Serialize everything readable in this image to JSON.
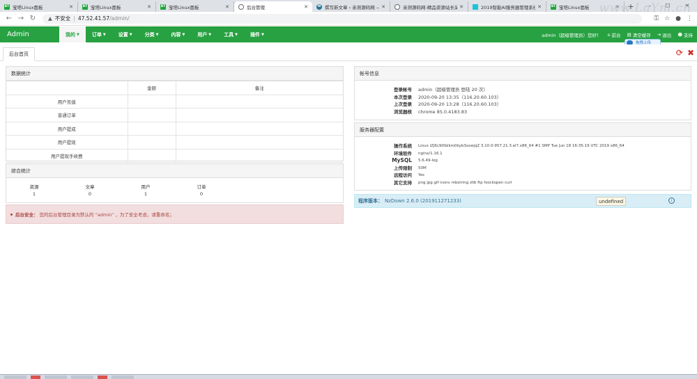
{
  "browser": {
    "tabs": [
      {
        "title": "宝塔Linux面板",
        "icon": "bt-icon",
        "active": false
      },
      {
        "title": "宝塔Linux面板",
        "icon": "bt-icon",
        "active": false
      },
      {
        "title": "宝塔Linux面板",
        "icon": "bt-icon",
        "active": false
      },
      {
        "title": "后台管理",
        "icon": "globe-icon",
        "active": true
      },
      {
        "title": "撰写新文章 ‹ 亲测源码网 —",
        "icon": "wordpress-icon",
        "active": false
      },
      {
        "title": "亲测源码网-精品资源站长采",
        "icon": "globe-icon",
        "active": false
      },
      {
        "title": "2019智能AI服务器管理系统",
        "icon": "cyan-icon",
        "active": false
      },
      {
        "title": "宝塔Linux面板",
        "icon": "bt-icon",
        "active": false
      }
    ],
    "security_label": "不安全",
    "url_host": "47.52.41.57",
    "url_path": "/admin/",
    "watermark": "www.LaYm.cn"
  },
  "navbar": {
    "brand": "Admin",
    "menu": [
      {
        "label": "我的",
        "active": true
      },
      {
        "label": "订单",
        "active": false
      },
      {
        "label": "设置",
        "active": false
      },
      {
        "label": "分类",
        "active": false
      },
      {
        "label": "内容",
        "active": false
      },
      {
        "label": "用户",
        "active": false
      },
      {
        "label": "工具",
        "active": false
      },
      {
        "label": "插件",
        "active": false
      }
    ],
    "greeting": "admin（超级管理员）您好！",
    "home": "前台",
    "cache": "清空缓存",
    "logout": "退出",
    "support": "支持",
    "upload_tip": "拖拽上传"
  },
  "content_tab": "后台首页",
  "data_stats": {
    "title": "数据统计",
    "headers": [
      "",
      "金额",
      "备注"
    ],
    "rows": [
      [
        "用户充值",
        "",
        ""
      ],
      [
        "普通订单",
        "",
        ""
      ],
      [
        "用户提成",
        "",
        ""
      ],
      [
        "用户提现",
        "",
        ""
      ],
      [
        "用户提现手续费",
        "",
        ""
      ]
    ]
  },
  "summary": {
    "title": "综合统计",
    "items": [
      {
        "label": "资源",
        "value": "1"
      },
      {
        "label": "文章",
        "value": "0"
      },
      {
        "label": "用户",
        "value": "1"
      },
      {
        "label": "订单",
        "value": "0"
      }
    ]
  },
  "alert": {
    "label": "后台安全：",
    "text": "您的后台管理目录为默认的 “admin” ，为了安全考虑，请重命名；"
  },
  "account": {
    "title": "帐号信息",
    "rows": [
      {
        "k": "登录帐号",
        "v": "admin（超级管理员 登陆 20 次）"
      },
      {
        "k": "本次登录",
        "v": "2020-09-20 13:35（116.20.60.103）"
      },
      {
        "k": "上次登录",
        "v": "2020-09-20 13:28（116.20.60.103）"
      },
      {
        "k": "浏览器核",
        "v": "chrome 85.0.4183.83"
      }
    ]
  },
  "server": {
    "title": "服务器配置",
    "rows": [
      {
        "k": "操作系统",
        "v": "Linux iZj6c90lbikm0kyb3sxwjqZ 3.10.0-957.21.3.el7.x86_64 #1 SMP Tue Jun 18 16:35:19 UTC 2019 x86_64"
      },
      {
        "k": "环境软件",
        "v": "nginx/1.16.1"
      },
      {
        "k": "MySQL",
        "v": "5.6.49-log"
      },
      {
        "k": "上传限制",
        "v": "50M"
      },
      {
        "k": "远程访问",
        "v": "Yes"
      },
      {
        "k": "其它支持",
        "v": "png jpg gif iconv mbstring zlib ftp fsockopen curl"
      }
    ]
  },
  "version": {
    "label": "程序版本：",
    "value": "NzDown 2.6.0 (201911271233)",
    "badge": "undefined"
  }
}
